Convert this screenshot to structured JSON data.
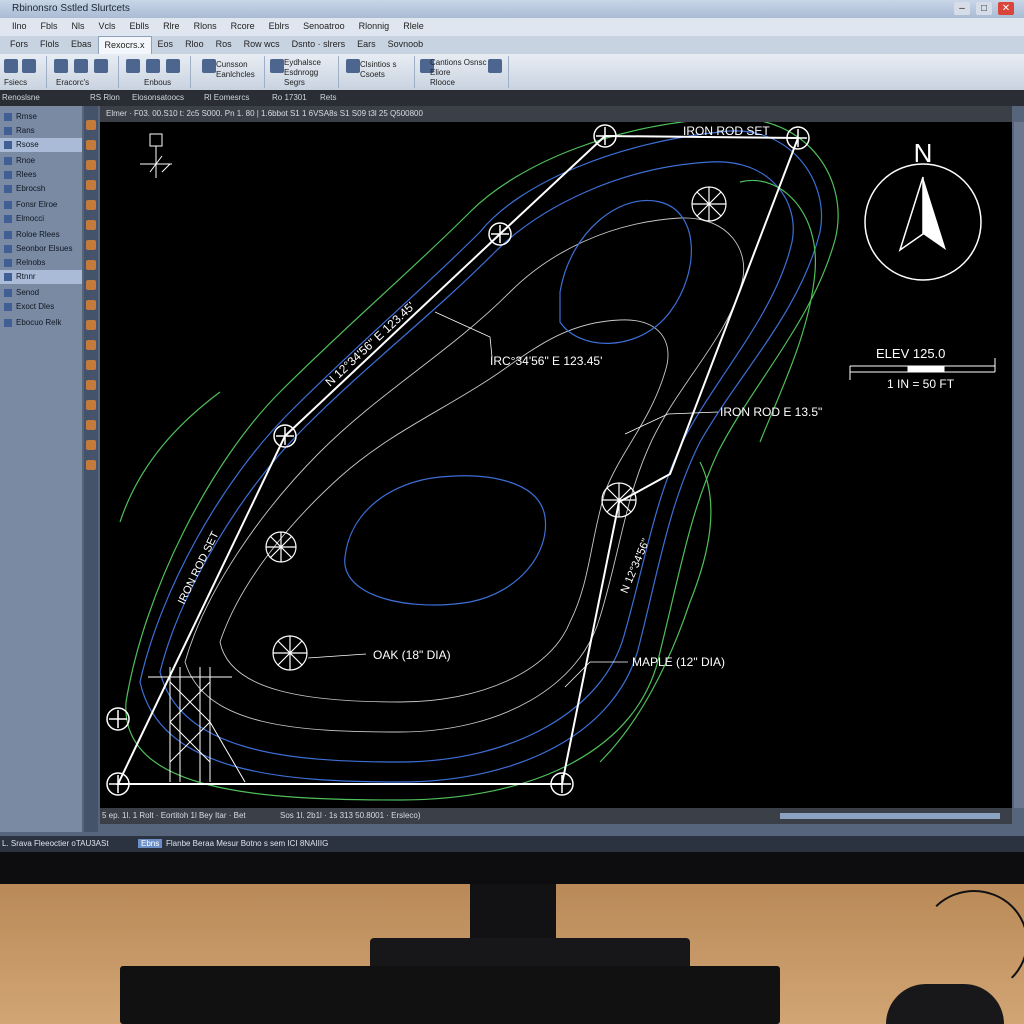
{
  "app": {
    "title": "Rbinonsro Sstled Slurtcets",
    "window_controls": [
      "–",
      "□",
      "✕"
    ]
  },
  "menu": [
    "Ilno",
    "Fbls",
    "Nls",
    "Vcls",
    "Eblls",
    "Rlre",
    "Rlons",
    "Rcore",
    "Eblrs",
    "Senoatroo",
    "Rlonnig",
    "Rlele"
  ],
  "tabs": [
    "Fors",
    "Flols",
    "Ebas",
    "Rexocrs.x",
    "Eos",
    "Rloo",
    "Ros",
    "Row wcs",
    "Dsnto · slrers",
    "Ears",
    "Sovnoob"
  ],
  "ribbon": {
    "groups": [
      {
        "label": "Fsiecs"
      },
      {
        "label": "Eracorc's"
      },
      {
        "label": "Enbous"
      },
      {
        "label": "Cunsson\nEanlchcles"
      },
      {
        "label": "Eydhalsce\nEsdnrogg\nSegrs"
      },
      {
        "label": "Clsintios s\nCsoets"
      },
      {
        "label": "Cantions Osnsc\nEliore\nRlooce"
      }
    ]
  },
  "command_bar": {
    "left": "Renoslsne",
    "items": [
      "RS Rlon",
      "Elosonsatoocs",
      "Rl Eomesrcs",
      "Ro 17301",
      "Rets"
    ]
  },
  "doc_command": "Elmer · F03. 00.S10 t: 2c5 S000. Pn 1. 80 | 1.6bbot  S1 1 6VSA8s  S1  S09 t3l 25  Q500800",
  "sidebar": {
    "items": [
      {
        "label": "Rmse"
      },
      {
        "label": "Rans"
      },
      {
        "label": "Rsose"
      },
      {
        "label": "Rnoe"
      },
      {
        "label": "Rlees"
      },
      {
        "label": "Ebrocsh"
      },
      {
        "label": "Fonsr Elroe"
      },
      {
        "label": "Elmocci"
      },
      {
        "label": "Roloe Rlees"
      },
      {
        "label": "Seonbor Elsues"
      },
      {
        "label": "Relnobs"
      },
      {
        "label": "Rtnnr"
      },
      {
        "label": "Senod"
      },
      {
        "label": "Exoct Dles"
      },
      {
        "label": "Ebocuo Relk"
      }
    ],
    "selected_index": 2
  },
  "drawing": {
    "labels": {
      "top_edge": "IRON ROD SET",
      "left_edge_bearing": "N 12°34'56\" E 123.45'",
      "center_bearing": "IRC°34'56\" E 123.45'",
      "right_marker": "IRON ROD E 13.5\"",
      "right_edge_bearing": "N 12°34'56\"",
      "left_edge_marker": "IRON ROD SET",
      "oak": "OAK (18\" DIA)",
      "maple": "MAPLE (12\" DIA)",
      "north": "N",
      "elevation": "ELEV 125.0",
      "scale": "1 IN = 50 FT"
    },
    "colors": {
      "parcel": "#ffffff",
      "contour_blue": "#3d6fd6",
      "contour_green": "#4fbf5a",
      "contour_white": "#c8c8c8",
      "background": "#000000"
    }
  },
  "hbar": {
    "left": "5 ep. 1l. 1 Rolt · Eortitoh 1l Bey  Itar · Bet",
    "middle": "Sos 1l. 2b1l · 1s 313   50.8001 · Ersleco)"
  },
  "statusbar": {
    "left": "L. Srava  Fleeoctier  oTAU3ASt",
    "highlight": "Ebns",
    "right": "Flanbe  Beraa Mesur Botno s sem ICI 8NAIIIG"
  }
}
